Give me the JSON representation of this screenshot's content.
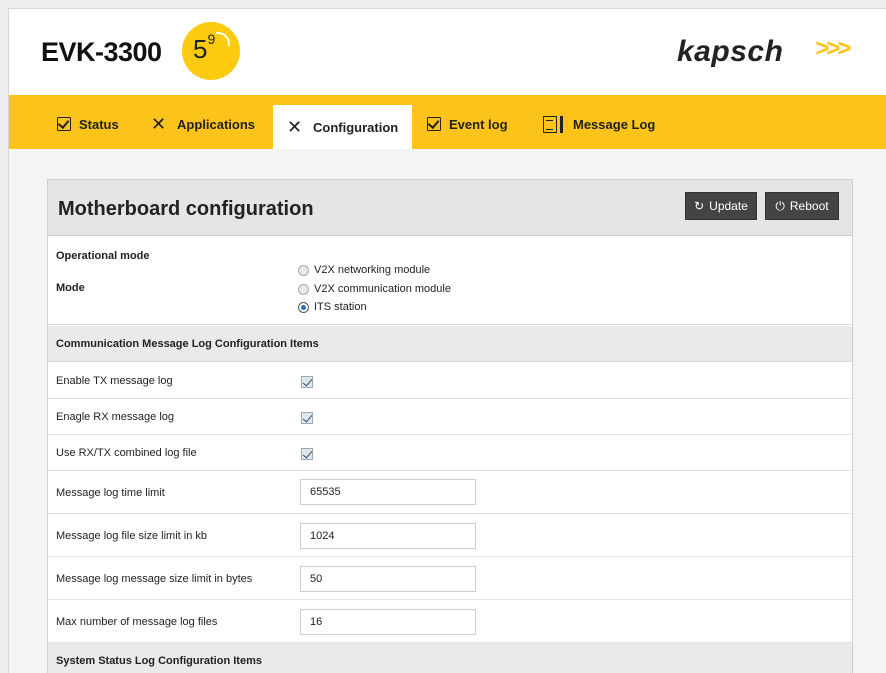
{
  "header": {
    "product": "EVK-3300",
    "badge_main": "5",
    "badge_sup": "9",
    "brand": "kapsch",
    "brand_arrows": ">>>"
  },
  "nav": {
    "items": [
      {
        "label": "Status",
        "icon": "check-square-icon"
      },
      {
        "label": "Applications",
        "icon": "tools-icon"
      },
      {
        "label": "Configuration",
        "icon": "tools-icon",
        "active": true
      },
      {
        "label": "Event log",
        "icon": "check-square-icon"
      },
      {
        "label": "Message Log",
        "icon": "message-log-icon"
      }
    ]
  },
  "panel": {
    "title": "Motherboard configuration",
    "update_label": "Update",
    "reboot_label": "Reboot"
  },
  "operational": {
    "heading": "Operational mode",
    "mode_label": "Mode",
    "options": [
      "V2X networking module",
      "V2X communication module",
      "ITS station"
    ],
    "selected": "ITS station"
  },
  "comm_log": {
    "heading": "Communication Message Log Configuration Items",
    "enable_tx_label": "Enable TX message log",
    "enable_tx_checked": true,
    "enable_rx_label": "Enagle RX message log",
    "enable_rx_checked": true,
    "combined_label": "Use RX/TX combined log file",
    "combined_checked": true,
    "time_limit_label": "Message log time limit",
    "time_limit_value": "65535",
    "file_size_label": "Message log file size limit in kb",
    "file_size_value": "1024",
    "msg_size_label": "Message log message size limit in bytes",
    "msg_size_value": "50",
    "max_files_label": "Max number of message log files",
    "max_files_value": "16"
  },
  "system_log": {
    "heading": "System Status Log Configuration Items"
  },
  "colors": {
    "nav_bg": "#fcc31b",
    "badge": "#fccb10",
    "button": "#444444"
  }
}
